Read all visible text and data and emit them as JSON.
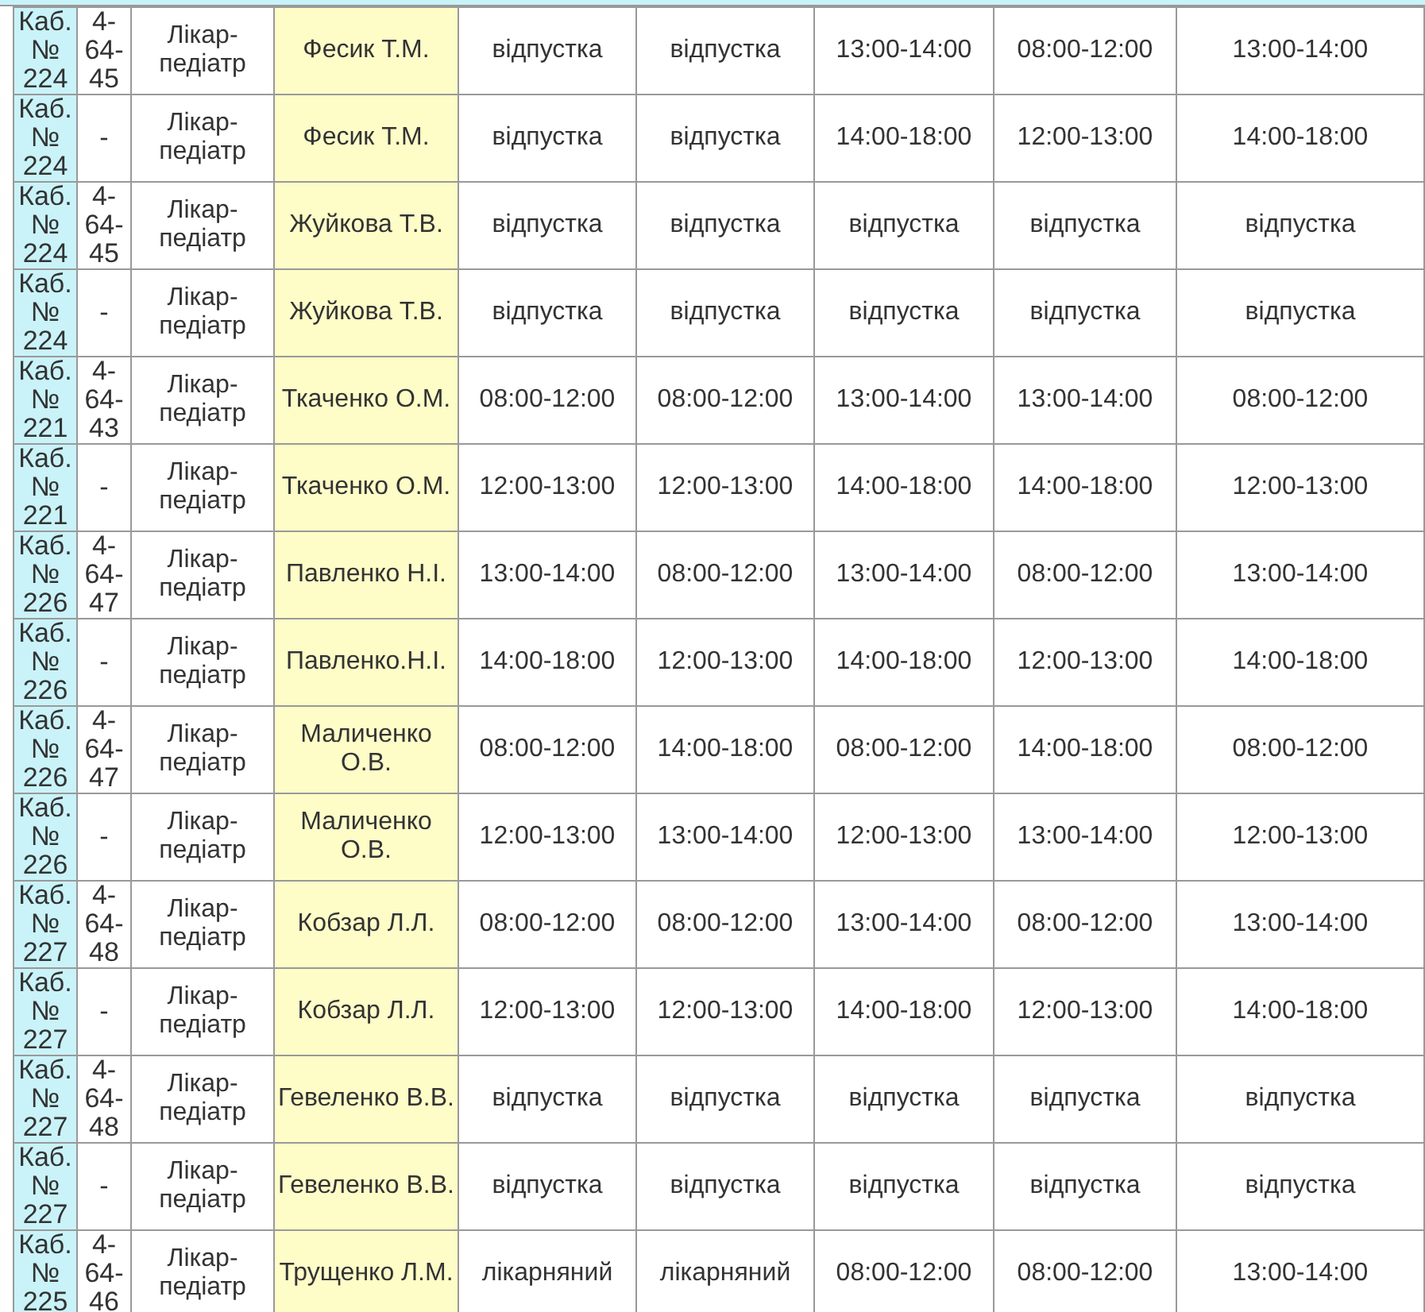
{
  "table": {
    "rows": [
      {
        "room": "Каб. № 224",
        "phone": "4-64-45",
        "position": "Лікар-педіатр",
        "doctor": "Фесик Т.М.",
        "days": [
          "відпустка",
          "відпустка",
          "13:00-14:00",
          "08:00-12:00",
          "13:00-14:00"
        ]
      },
      {
        "room": "Каб. № 224",
        "phone": "-",
        "position": "Лікар-педіатр",
        "doctor": "Фесик Т.М.",
        "days": [
          "відпустка",
          "відпустка",
          "14:00-18:00",
          "12:00-13:00",
          "14:00-18:00"
        ]
      },
      {
        "room": "Каб. № 224",
        "phone": "4-64-45",
        "position": "Лікар-педіатр",
        "doctor": "Жуйкова Т.В.",
        "days": [
          "відпустка",
          "відпустка",
          "відпустка",
          "відпустка",
          "відпустка"
        ]
      },
      {
        "room": "Каб. № 224",
        "phone": "-",
        "position": "Лікар-педіатр",
        "doctor": "Жуйкова Т.В.",
        "days": [
          "відпустка",
          "відпустка",
          "відпустка",
          "відпустка",
          "відпустка"
        ]
      },
      {
        "room": "Каб. № 221",
        "phone": "4-64-43",
        "position": "Лікар-педіатр",
        "doctor": "Ткаченко О.М.",
        "days": [
          "08:00-12:00",
          "08:00-12:00",
          "13:00-14:00",
          "13:00-14:00",
          "08:00-12:00"
        ]
      },
      {
        "room": "Каб. № 221",
        "phone": "-",
        "position": "Лікар-педіатр",
        "doctor": "Ткаченко О.М.",
        "days": [
          "12:00-13:00",
          "12:00-13:00",
          "14:00-18:00",
          "14:00-18:00",
          "12:00-13:00"
        ]
      },
      {
        "room": "Каб. № 226",
        "phone": "4-64-47",
        "position": "Лікар-педіатр",
        "doctor": "Павленко Н.І.",
        "days": [
          "13:00-14:00",
          "08:00-12:00",
          "13:00-14:00",
          "08:00-12:00",
          "13:00-14:00"
        ]
      },
      {
        "room": "Каб. № 226",
        "phone": "-",
        "position": "Лікар-педіатр",
        "doctor": "Павленко.Н.І.",
        "days": [
          "14:00-18:00",
          "12:00-13:00",
          "14:00-18:00",
          "12:00-13:00",
          "14:00-18:00"
        ]
      },
      {
        "room": "Каб. № 226",
        "phone": "4-64-47",
        "position": "Лікар-педіатр",
        "doctor": "Маличенко О.В.",
        "days": [
          "08:00-12:00",
          "14:00-18:00",
          "08:00-12:00",
          "14:00-18:00",
          "08:00-12:00"
        ]
      },
      {
        "room": "Каб. № 226",
        "phone": "-",
        "position": "Лікар-педіатр",
        "doctor": "Маличенко О.В.",
        "days": [
          "12:00-13:00",
          "13:00-14:00",
          "12:00-13:00",
          "13:00-14:00",
          "12:00-13:00"
        ]
      },
      {
        "room": "Каб. № 227",
        "phone": "4-64-48",
        "position": "Лікар-педіатр",
        "doctor": "Кобзар Л.Л.",
        "days": [
          "08:00-12:00",
          "08:00-12:00",
          "13:00-14:00",
          "08:00-12:00",
          "13:00-14:00"
        ]
      },
      {
        "room": "Каб. № 227",
        "phone": "-",
        "position": "Лікар-педіатр",
        "doctor": "Кобзар Л.Л.",
        "days": [
          "12:00-13:00",
          "12:00-13:00",
          "14:00-18:00",
          "12:00-13:00",
          "14:00-18:00"
        ]
      },
      {
        "room": "Каб. № 227",
        "phone": "4-64-48",
        "position": "Лікар-педіатр",
        "doctor": "Гевеленко В.В.",
        "days": [
          "відпустка",
          "відпустка",
          "відпустка",
          "відпустка",
          "відпустка"
        ]
      },
      {
        "room": "Каб. № 227",
        "phone": "-",
        "position": "Лікар-педіатр",
        "doctor": "Гевеленко В.В.",
        "days": [
          "відпустка",
          "відпустка",
          "відпустка",
          "відпустка",
          "відпустка"
        ]
      },
      {
        "room": "Каб. № 225",
        "phone": "4-64-46",
        "position": "Лікар-педіатр",
        "doctor": "Трущенко Л.М.",
        "days": [
          "лікарняний",
          "лікарняний",
          "08:00-12:00",
          "08:00-12:00",
          "13:00-14:00"
        ]
      }
    ]
  }
}
